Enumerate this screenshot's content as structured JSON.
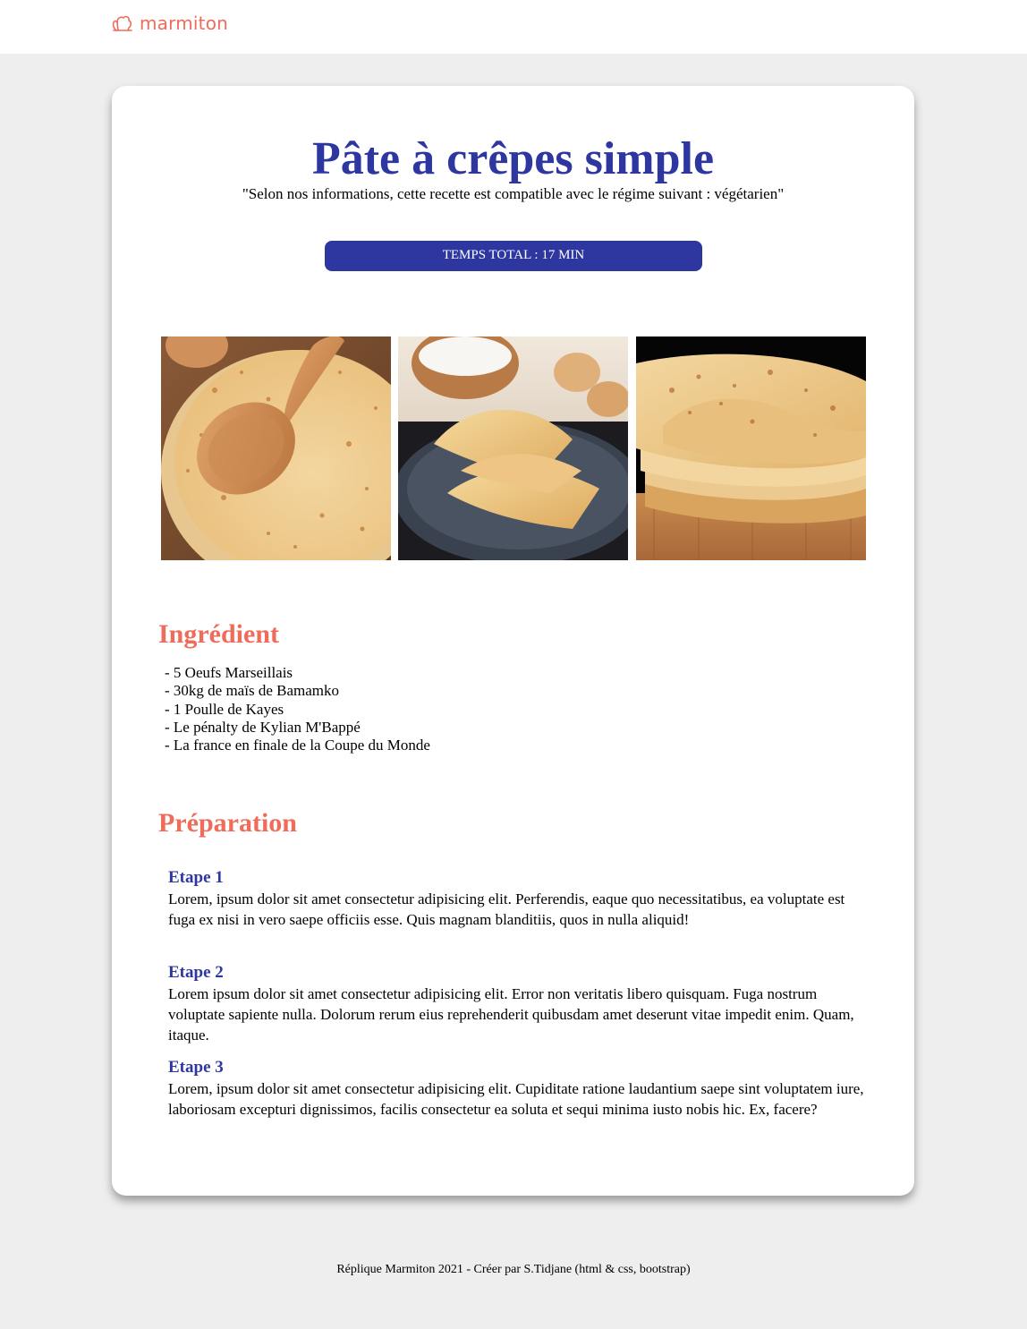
{
  "header": {
    "logo_text": "marmiton",
    "brand_color": "#f06c5a",
    "logo_icon": "chef-hat-icon"
  },
  "recipe": {
    "title": "Pâte à crêpes simple",
    "regime": "\"Selon nos informations, cette recette est compatible avec le régime suivant : végétarien\"",
    "total_time": "TEMPS TOTAL : 17 MIN",
    "accent_color": "#2e36a0",
    "photos": [
      "crepes-wooden-spoon-photo",
      "folded-crepes-plate-photo",
      "crepes-stack-photo"
    ]
  },
  "ingredients": {
    "heading": "Ingrédient",
    "items": [
      "- 5 Oeufs Marseillais",
      "- 30kg de maïs de Bamamko",
      "- 1 Poulle de Kayes",
      "- Le pénalty de Kylian M'Bappé",
      "- La france en finale de la Coupe du Monde"
    ]
  },
  "preparation": {
    "heading": "Préparation",
    "steps": [
      {
        "title": "Etape 1",
        "text": "Lorem, ipsum dolor sit amet consectetur adipisicing elit. Perferendis, eaque quo necessitatibus, ea voluptate est fuga ex nisi in vero saepe officiis esse. Quis magnam blanditiis, quos in nulla aliquid!"
      },
      {
        "title": "Etape 2",
        "text": "Lorem ipsum dolor sit amet consectetur adipisicing elit. Error non veritatis libero quisquam. Fuga nostrum voluptate sapiente nulla. Dolorum rerum eius reprehenderit quibusdam amet deserunt vitae impedit enim. Quam, itaque."
      },
      {
        "title": "Etape 3",
        "text": "Lorem, ipsum dolor sit amet consectetur adipisicing elit. Cupiditate ratione laudantium saepe sint voluptatem iure, laboriosam excepturi dignissimos, facilis consectetur ea soluta et sequi minima iusto nobis hic. Ex, facere?"
      }
    ]
  },
  "footer": {
    "text": "Réplique Marmiton 2021 - Créer par S.Tidjane (html & css, bootstrap)"
  }
}
